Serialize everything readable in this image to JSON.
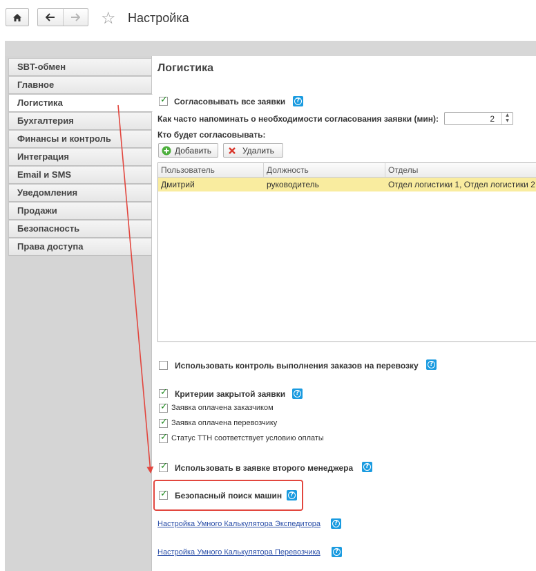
{
  "window": {
    "title": "Настройка"
  },
  "toolbar": {
    "home_icon": "home-icon",
    "back_icon": "arrow-left-icon",
    "forward_icon": "arrow-right-icon",
    "favorite_icon": "star-icon"
  },
  "sidebar": {
    "items": [
      {
        "label": "SBT-обмен",
        "active": false
      },
      {
        "label": "Главное",
        "active": false
      },
      {
        "label": "Логистика",
        "active": true
      },
      {
        "label": "Бухгалтерия",
        "active": false
      },
      {
        "label": "Финансы и контроль",
        "active": false
      },
      {
        "label": "Интеграция",
        "active": false
      },
      {
        "label": "Email и SMS",
        "active": false
      },
      {
        "label": "Уведомления",
        "active": false
      },
      {
        "label": "Продажи",
        "active": false
      },
      {
        "label": "Безопасность",
        "active": false
      },
      {
        "label": "Права доступа",
        "active": false
      }
    ]
  },
  "main": {
    "heading": "Логистика",
    "approve_all": {
      "label": "Согласовывать все заявки",
      "checked": true
    },
    "remind": {
      "label": "Как часто напоминать о необходимости согласования заявки (мин):",
      "value": "2"
    },
    "approvers_label": "Кто будет согласовывать:",
    "add_button": "Добавить",
    "delete_button": "Удалить",
    "table": {
      "columns": [
        "Пользователь",
        "Должность",
        "Отделы"
      ],
      "rows": [
        [
          "Дмитрий",
          "руководитель",
          "Отдел логистики 1, Отдел логистики 2"
        ]
      ]
    },
    "control_orders": {
      "label": "Использовать контроль выполнения заказов на перевозку",
      "checked": false
    },
    "close_criteria": {
      "label": "Критерии закрытой заявки",
      "checked": true
    },
    "criteria": [
      {
        "label": "Заявка оплачена заказчиком",
        "checked": true
      },
      {
        "label": "Заявка оплачена перевозчику",
        "checked": true
      },
      {
        "label": "Статус ТТН соответствует условию оплаты",
        "checked": true
      }
    ],
    "second_manager": {
      "label": "Использовать в заявке второго менеджера",
      "checked": true
    },
    "safe_search": {
      "label": "Безопасный поиск машин",
      "checked": true
    },
    "links": [
      "Настройка Умного Калькулятора Экспедитора",
      "Настройка Умного Калькулятора Перевозчика"
    ]
  },
  "colors": {
    "accent": "#1a9be0",
    "row_selected": "#f9ec9f",
    "annotation": "#e2463e",
    "check": "#1e8a1e"
  }
}
